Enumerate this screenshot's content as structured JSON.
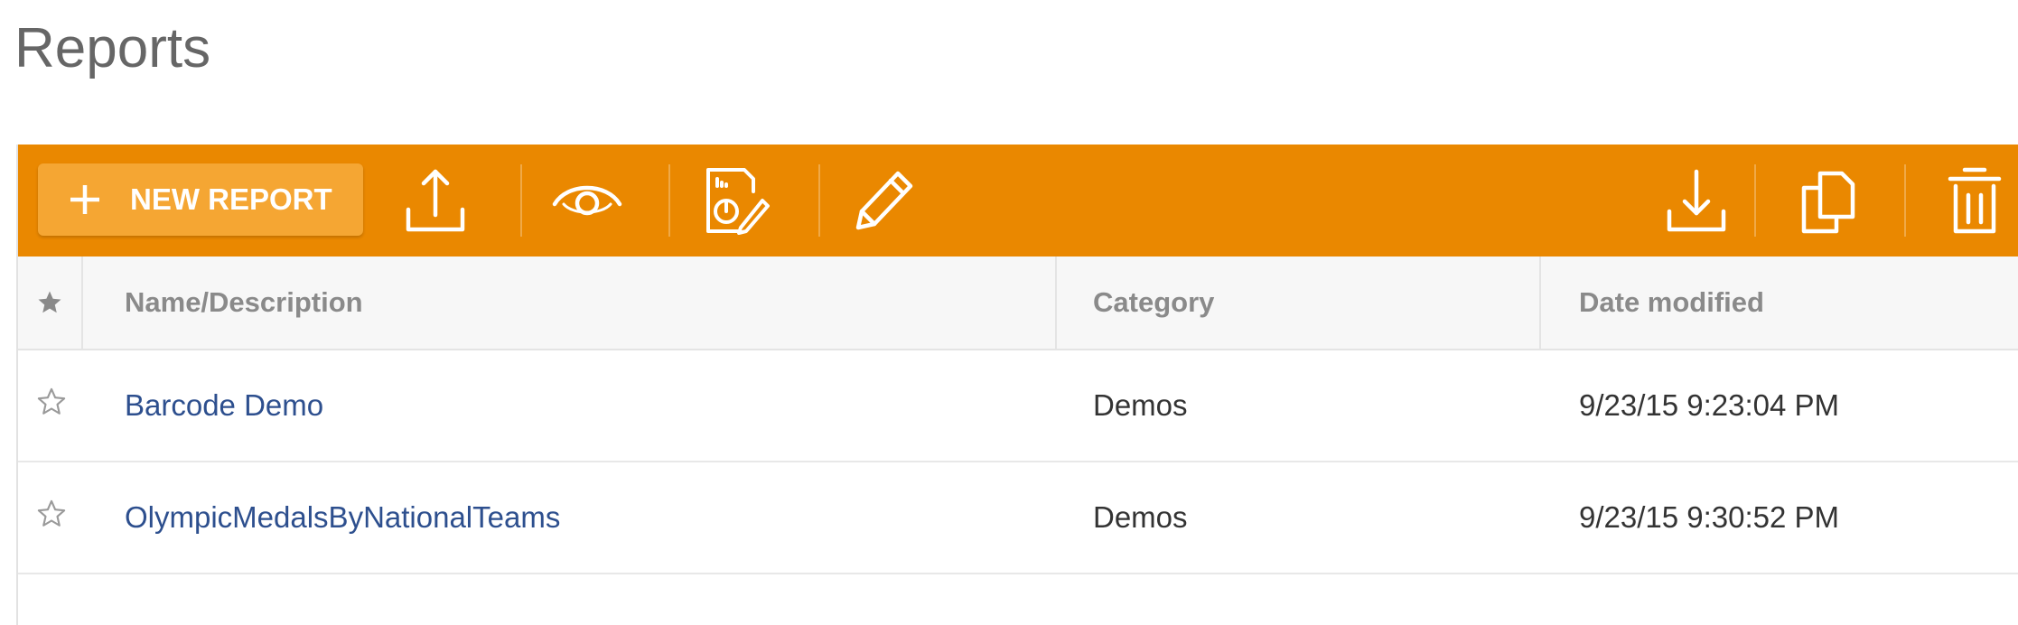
{
  "page": {
    "title": "Reports"
  },
  "toolbar": {
    "new_report_label": "NEW REPORT",
    "left_icons": [
      "upload-icon",
      "preview-icon",
      "design-report-icon",
      "edit-icon"
    ],
    "right_icons": [
      "download-icon",
      "copy-icon",
      "delete-icon"
    ],
    "colors": {
      "background": "#ea8800",
      "button": "#f5a633",
      "icon": "#ffffff"
    }
  },
  "grid": {
    "columns": {
      "favorite_icon": "star-filled-icon",
      "name": "Name/Description",
      "category": "Category",
      "date_modified": "Date modified"
    },
    "rows": [
      {
        "favorite_icon": "star-outline-icon",
        "name": "Barcode Demo",
        "category": "Demos",
        "date_modified": "9/23/15 9:23:04 PM"
      },
      {
        "favorite_icon": "star-outline-icon",
        "name": "OlympicMedalsByNationalTeams",
        "category": "Demos",
        "date_modified": "9/23/15 9:30:52 PM"
      }
    ],
    "colors": {
      "link": "#2d4f8e",
      "header_text": "#8a8a8a",
      "text": "#333333"
    }
  }
}
